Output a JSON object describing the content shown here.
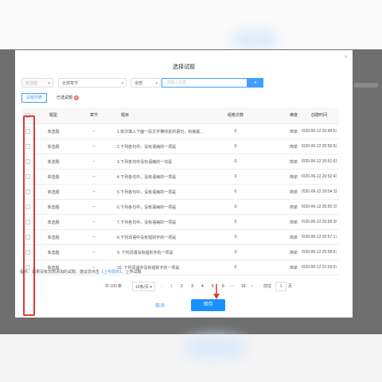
{
  "modal": {
    "title": "选择试题",
    "close_glyph": "×"
  },
  "filters": {
    "type_placeholder": "单选题",
    "chapter_value": "全部章节",
    "difficulty_value": "全部",
    "search_placeholder": "请输入内容",
    "search_glyph": "⌕"
  },
  "tabs": {
    "list_label": "试题列表",
    "selected_label": "已选试题",
    "selected_count": "0"
  },
  "table": {
    "headers": {
      "type": "题型",
      "chapter": "章节",
      "question": "题目",
      "count": "组卷次数",
      "difficulty": "难度",
      "created": "创建时间"
    },
    "rows": [
      {
        "type": "单选题",
        "chapter": "--",
        "question": "1.依次填入下面一段文字横线处的语句，衔接最...",
        "count": "0",
        "difficulty": "简单",
        "created": "2020-06-12 20:48:53"
      },
      {
        "type": "单选题",
        "chapter": "--",
        "question": "2.下列各句中，没有语病的一项是",
        "count": "0",
        "difficulty": "简单",
        "created": "2020-06-12 20:50:52"
      },
      {
        "type": "单选题",
        "chapter": "--",
        "question": "3.下列各句中没有语病的一句是",
        "count": "0",
        "difficulty": "简单",
        "created": "2020-06-12 20:51:51"
      },
      {
        "type": "单选题",
        "chapter": "--",
        "question": "4.下列各句中，没有语病的一项是",
        "count": "0",
        "difficulty": "简单",
        "created": "2020-06-12 20:52:43"
      },
      {
        "type": "单选题",
        "chapter": "--",
        "question": "5.下列各句中，没有语病的一项是",
        "count": "0",
        "difficulty": "简单",
        "created": "2020-06-12 20:54:11"
      },
      {
        "type": "单选题",
        "chapter": "--",
        "question": "6.下列各句中，没有语病的一项是",
        "count": "0",
        "difficulty": "简单",
        "created": "2020-06-12 20:55:15"
      },
      {
        "type": "单选题",
        "chapter": "--",
        "question": "7.下列各句中，没有语病的一项是",
        "count": "0",
        "difficulty": "简单",
        "created": "2020-06-12 20:56:38"
      },
      {
        "type": "单选题",
        "chapter": "--",
        "question": "8.下列词语中没有错别字的一项是",
        "count": "0",
        "difficulty": "简单",
        "created": "2020-06-12 20:57:17"
      },
      {
        "type": "单选题",
        "chapter": "--",
        "question": "9. 下列词语没有错别字的一项是",
        "count": "0",
        "difficulty": "简单",
        "created": "2020-06-12 20:58:57"
      },
      {
        "type": "单选题",
        "chapter": "--",
        "question": "10. 下列词语中没有错别字的一项是",
        "count": "0",
        "difficulty": "简单",
        "created": "2020-06-12 21:03:07"
      }
    ]
  },
  "tip": {
    "prefix": "提示：如果没有您想添加的试题，建议您点击",
    "link": "【上传题库】",
    "suffix": "，上传试题"
  },
  "pagination": {
    "total": "共 100 条",
    "page_size": "10条/页",
    "prev": "‹",
    "pages": [
      "1",
      "2",
      "3",
      "4",
      "5",
      "6"
    ],
    "ellipsis": "···",
    "last": "10",
    "next": "›",
    "goto_label": "前往",
    "goto_value": "1",
    "goto_suffix": "页"
  },
  "footer": {
    "cancel_label": "取消",
    "save_label": "保存"
  },
  "colors": {
    "accent": "#409eff",
    "save": "#1890ff",
    "highlight": "#e53935",
    "badge": "#f56c6c"
  }
}
